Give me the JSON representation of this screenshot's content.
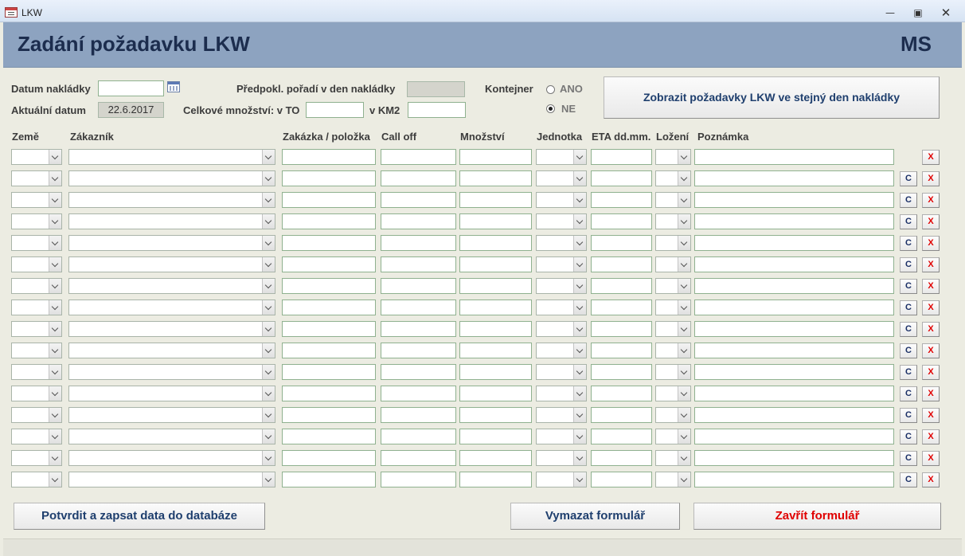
{
  "window": {
    "title": "LKW",
    "icon": "access-form-icon"
  },
  "header": {
    "title": "Zadání požadavku LKW",
    "user": "MS"
  },
  "form": {
    "datum_nakladky_label": "Datum nakládky",
    "datum_nakladky_value": "",
    "aktualni_datum_label": "Aktuální datum",
    "aktualni_datum_value": "22.6.2017",
    "poradi_label": "Předpokl. pořadí v den nakládky",
    "celkove_label": "Celkové množství:  v TO",
    "km2_label": "v KM2",
    "kontejner_label": "Kontejner",
    "ano_label": "ANO",
    "ne_label": "NE",
    "kontejner_selected": "NE",
    "zobrazit_button": "Zobrazit požadavky LKW ve stejný den nakládky"
  },
  "columns": [
    "Země",
    "Zákazník",
    "Zakázka / položka",
    "Call off",
    "Množství",
    "Jednotka",
    "ETA dd.mm.",
    "Ložení",
    "Poznámka"
  ],
  "row_buttons": {
    "copy": "C",
    "delete": "X"
  },
  "footer": {
    "confirm_button": "Potvrdit a zapsat data do databáze",
    "clear_button": "Vymazat formulář",
    "close_button": "Zavřít formulář"
  }
}
